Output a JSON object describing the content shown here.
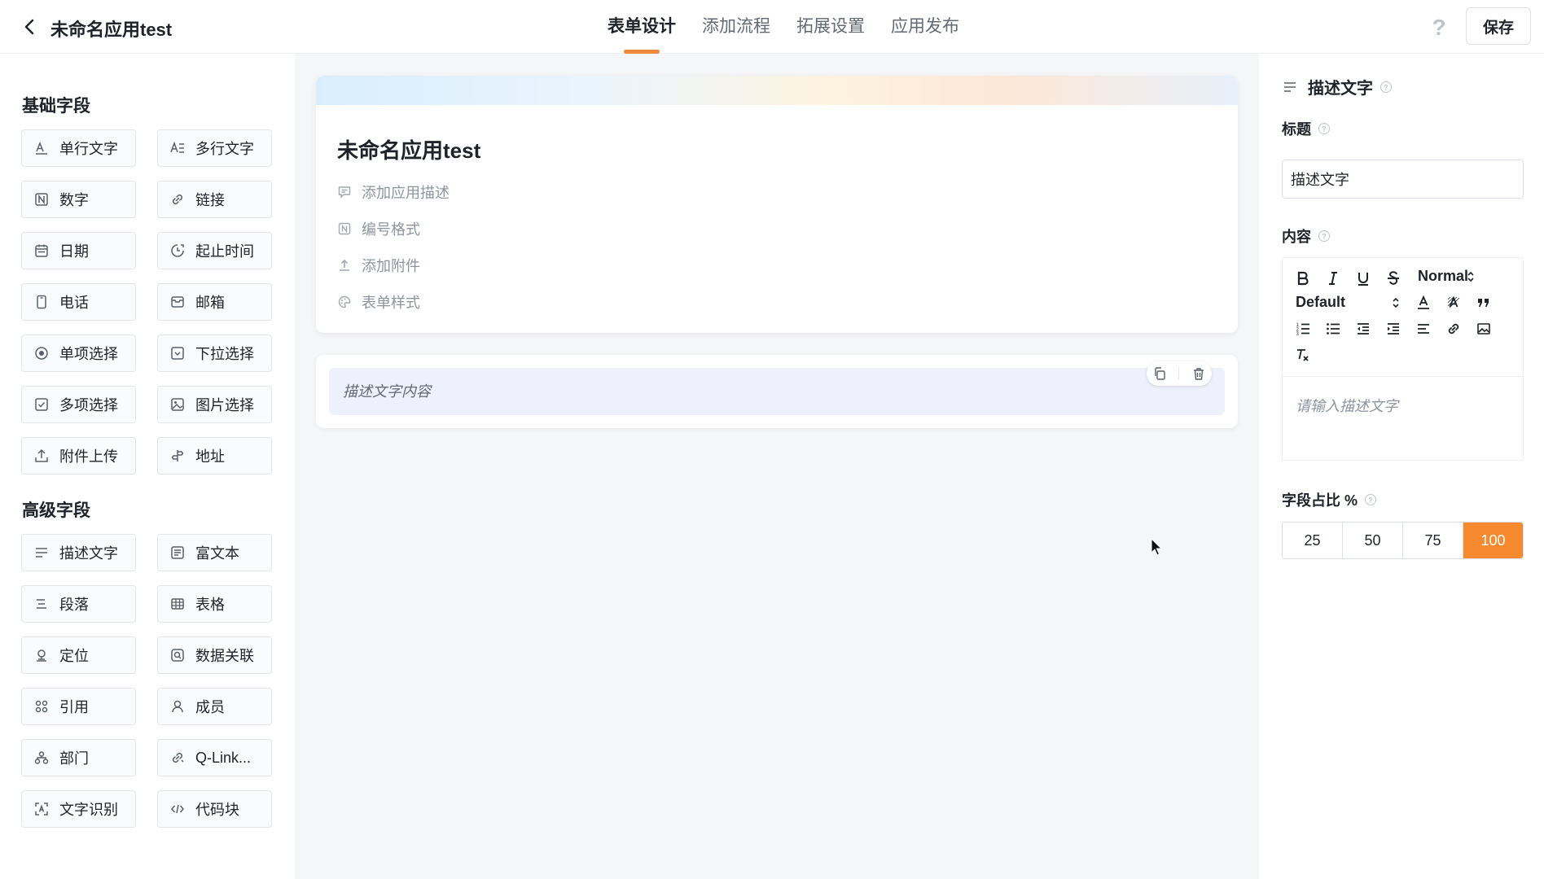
{
  "header": {
    "app_title": "未命名应用test",
    "tabs": [
      "表单设计",
      "添加流程",
      "拓展设置",
      "应用发布"
    ],
    "active_tab": 0,
    "save_label": "保存"
  },
  "left_panel": {
    "basic_title": "基础字段",
    "basic_fields": [
      {
        "label": "单行文字",
        "icon": "single-line-text-icon"
      },
      {
        "label": "多行文字",
        "icon": "multi-line-text-icon"
      },
      {
        "label": "数字",
        "icon": "number-icon"
      },
      {
        "label": "链接",
        "icon": "link-icon"
      },
      {
        "label": "日期",
        "icon": "calendar-icon"
      },
      {
        "label": "起止时间",
        "icon": "time-range-icon"
      },
      {
        "label": "电话",
        "icon": "phone-icon"
      },
      {
        "label": "邮箱",
        "icon": "mail-icon"
      },
      {
        "label": "单项选择",
        "icon": "radio-icon"
      },
      {
        "label": "下拉选择",
        "icon": "dropdown-icon"
      },
      {
        "label": "多项选择",
        "icon": "checkbox-icon"
      },
      {
        "label": "图片选择",
        "icon": "image-icon"
      },
      {
        "label": "附件上传",
        "icon": "upload-icon"
      },
      {
        "label": "地址",
        "icon": "address-icon"
      }
    ],
    "advanced_title": "高级字段",
    "advanced_fields": [
      {
        "label": "描述文字",
        "icon": "description-icon"
      },
      {
        "label": "富文本",
        "icon": "rich-text-icon"
      },
      {
        "label": "段落",
        "icon": "paragraph-icon"
      },
      {
        "label": "表格",
        "icon": "table-icon"
      },
      {
        "label": "定位",
        "icon": "location-icon"
      },
      {
        "label": "数据关联",
        "icon": "data-link-icon"
      },
      {
        "label": "引用",
        "icon": "reference-icon"
      },
      {
        "label": "成员",
        "icon": "member-icon"
      },
      {
        "label": "部门",
        "icon": "department-icon"
      },
      {
        "label": "Q-Link...",
        "icon": "q-link-icon"
      },
      {
        "label": "文字识别",
        "icon": "ocr-icon"
      },
      {
        "label": "代码块",
        "icon": "code-icon"
      }
    ]
  },
  "canvas": {
    "form_title": "未命名应用test",
    "meta_items": [
      "添加应用描述",
      "编号格式",
      "添加附件",
      "表单样式"
    ],
    "desc_field_text": "描述文字内容"
  },
  "right_panel": {
    "field_type": "描述文字",
    "title_label": "标题",
    "title_value": "描述文字",
    "content_label": "内容",
    "header_select": "Normal",
    "font_select": "Default",
    "content_placeholder": "请输入描述文字",
    "width_label": "字段占比 %",
    "width_options": [
      "25",
      "50",
      "75",
      "100"
    ],
    "width_selected": "100"
  },
  "colors": {
    "accent": "#f7892f",
    "tab_underline": "#f08a3c",
    "canvas_bg": "#f5f6f8",
    "field_highlight": "#eef0fb"
  }
}
